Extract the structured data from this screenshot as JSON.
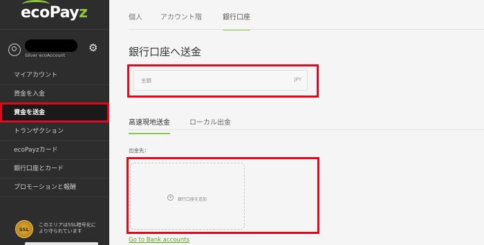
{
  "sidebar": {
    "logo_main": "ecoPay",
    "logo_z": "z",
    "user_level": "Silver ecoAccount",
    "items": [
      {
        "label": "マイアカウント"
      },
      {
        "label": "資金を入金"
      },
      {
        "label": "資金を送金"
      },
      {
        "label": "トランザクション"
      },
      {
        "label": "ecoPayzカード"
      },
      {
        "label": "銀行口座とカード"
      },
      {
        "label": "プロモーションと報酬"
      }
    ],
    "ssl_badge": "SSL",
    "ssl_text": "このエリアはSSL暗号化により守られています"
  },
  "main": {
    "top_tabs": [
      {
        "label": "個人"
      },
      {
        "label": "アカウント階"
      },
      {
        "label": "銀行口座"
      }
    ],
    "title": "銀行口座へ送金",
    "amount_label": "金額",
    "currency": "JPY",
    "sub_tabs": [
      {
        "label": "高速現地送金"
      },
      {
        "label": "ローカル出金"
      }
    ],
    "destination_label": "出金先：",
    "add_bank_text": "銀行口座を追加",
    "bank_link": "Go to Bank accounts"
  },
  "colors": {
    "accent": "#8dc63f",
    "highlight": "#e1081c",
    "sidebar_bg": "#2d2d2d"
  }
}
